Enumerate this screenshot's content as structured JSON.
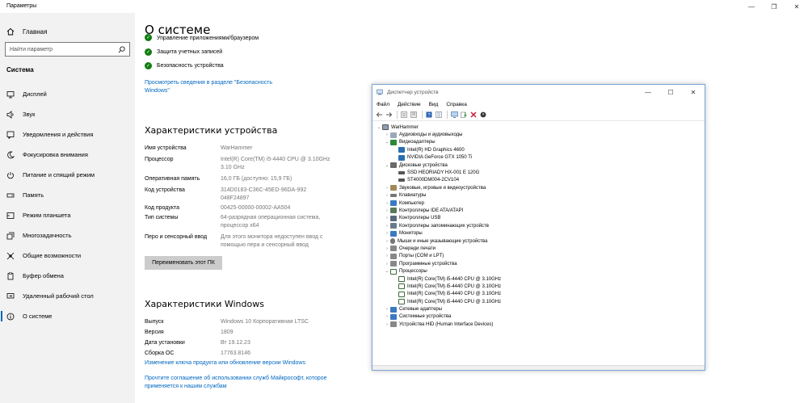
{
  "app_title": "Параметры",
  "window_controls": [
    "—",
    "❐",
    "✕"
  ],
  "sidebar": {
    "home_label": "Главная",
    "search_placeholder": "Найти параметр",
    "section_title": "Система",
    "items": [
      {
        "label": "Дисплей",
        "icon": "display-icon"
      },
      {
        "label": "Звук",
        "icon": "sound-icon"
      },
      {
        "label": "Уведомления и действия",
        "icon": "notifications-icon"
      },
      {
        "label": "Фокусировка внимания",
        "icon": "moon-icon"
      },
      {
        "label": "Питание и спящий режим",
        "icon": "power-icon"
      },
      {
        "label": "Память",
        "icon": "storage-icon"
      },
      {
        "label": "Режим планшета",
        "icon": "tablet-icon"
      },
      {
        "label": "Многозадачность",
        "icon": "multitasking-icon"
      },
      {
        "label": "Общие возможности",
        "icon": "shared-icon"
      },
      {
        "label": "Буфер обмена",
        "icon": "clipboard-icon"
      },
      {
        "label": "Удаленный рабочий стол",
        "icon": "remote-desktop-icon"
      },
      {
        "label": "О системе",
        "icon": "info-icon"
      }
    ]
  },
  "main": {
    "page_title": "О системе",
    "security": {
      "items": [
        "Управление приложениями/браузером",
        "Защита учетных записей",
        "Безопасность устройства"
      ],
      "link": "Просмотреть сведения в разделе \"Безопасность Windows\""
    },
    "device_specs": {
      "heading": "Характеристики устройства",
      "rows": [
        {
          "k": "Имя устройства",
          "v": "WarHammer"
        },
        {
          "k": "Процессор",
          "v": "Intel(R) Core(TM) i5-4440 CPU @ 3.10GHz 3.10 GHz"
        },
        {
          "k": "Оперативная память",
          "v": "16,0 ГБ (доступно: 15,9 ГБ)"
        },
        {
          "k": "Код устройства",
          "v": "314D0183-C36C-45ED-96DA-992048F24897"
        },
        {
          "k": "Код продукта",
          "v": "00425-00000-00002-AA504"
        },
        {
          "k": "Тип системы",
          "v": "64-разрядная операционная система, процессор x64"
        },
        {
          "k": "Перо и сенсорный ввод",
          "v": "Для этого монитора недоступен ввод с помощью пера и сенсорный ввод"
        }
      ],
      "rename_button": "Переименовать этот ПК"
    },
    "windows_specs": {
      "heading": "Характеристики Windows",
      "rows": [
        {
          "k": "Выпуск",
          "v": "Windows 10 Корпоративная LTSC"
        },
        {
          "k": "Версия",
          "v": "1809"
        },
        {
          "k": "Дата установки",
          "v": "Вт 19.12.23"
        },
        {
          "k": "Сборка ОС",
          "v": "17763.8146"
        }
      ],
      "link_key": "Изменение ключа продукта или обновление версии Windows",
      "link_license": "Прочтите соглашение об использовании служб Майкрософт, которое применяется к нашим службам"
    }
  },
  "device_manager": {
    "title": "Диспетчер устройств",
    "menu": [
      "Файл",
      "Действие",
      "Вид",
      "Справка"
    ],
    "tree": [
      {
        "level": 0,
        "exp": "⌄",
        "label": "WarHammer",
        "color": "#6a6a6a"
      },
      {
        "level": 1,
        "exp": "›",
        "label": "Аудиовходы и аудиовыходы",
        "color": "#7a8a99"
      },
      {
        "level": 1,
        "exp": "⌄",
        "label": "Видеоадаптеры",
        "color": "#2a8a3a"
      },
      {
        "level": 2,
        "exp": "",
        "label": "Intel(R) HD Graphics 4600",
        "color": "#2a6fb0"
      },
      {
        "level": 2,
        "exp": "",
        "label": "NVIDIA GeForce GTX 1050 Ti",
        "color": "#2a6fb0"
      },
      {
        "level": 1,
        "exp": "⌄",
        "label": "Дисковые устройства",
        "color": "#666666"
      },
      {
        "level": 2,
        "exp": "",
        "label": "SSD  HEORIADY  HX-001  E  120G",
        "color": "#555555"
      },
      {
        "level": 2,
        "exp": "",
        "label": "ST4000DM004-2CV104",
        "color": "#555555"
      },
      {
        "level": 1,
        "exp": "›",
        "label": "Звуковые, игровые и видеоустройства",
        "color": "#8a7a5a"
      },
      {
        "level": 1,
        "exp": "›",
        "label": "Клавиатуры",
        "color": "#666666"
      },
      {
        "level": 1,
        "exp": "›",
        "label": "Компьютер",
        "color": "#3a7ac0"
      },
      {
        "level": 1,
        "exp": "›",
        "label": "Контроллеры IDE ATA/ATAPI",
        "color": "#5a7a5a"
      },
      {
        "level": 1,
        "exp": "›",
        "label": "Контроллеры USB",
        "color": "#5a6a7a"
      },
      {
        "level": 1,
        "exp": "›",
        "label": "Контроллеры запоминающих устройств",
        "color": "#6a7a8a"
      },
      {
        "level": 1,
        "exp": "›",
        "label": "Мониторы",
        "color": "#3a7ac0"
      },
      {
        "level": 1,
        "exp": "›",
        "label": "Мыши и иные указывающие устройства",
        "color": "#777777"
      },
      {
        "level": 1,
        "exp": "›",
        "label": "Очереди печати",
        "color": "#777777"
      },
      {
        "level": 1,
        "exp": "›",
        "label": "Порты (COM и LPT)",
        "color": "#777777"
      },
      {
        "level": 1,
        "exp": "›",
        "label": "Программные устройства",
        "color": "#777777"
      },
      {
        "level": 1,
        "exp": "⌄",
        "label": "Процессоры",
        "color": "#3a6a3a"
      },
      {
        "level": 2,
        "exp": "",
        "label": "Intel(R) Core(TM) i5-4440 CPU @ 3.10GHz",
        "color": "#3a6a3a"
      },
      {
        "level": 2,
        "exp": "",
        "label": "Intel(R) Core(TM) i5-4440 CPU @ 3.10GHz",
        "color": "#3a6a3a"
      },
      {
        "level": 2,
        "exp": "",
        "label": "Intel(R) Core(TM) i5-4440 CPU @ 3.10GHz",
        "color": "#3a6a3a"
      },
      {
        "level": 2,
        "exp": "",
        "label": "Intel(R) Core(TM) i5-4440 CPU @ 3.10GHz",
        "color": "#3a6a3a"
      },
      {
        "level": 1,
        "exp": "›",
        "label": "Сетевые адаптеры",
        "color": "#3a7ac0"
      },
      {
        "level": 1,
        "exp": "›",
        "label": "Системные устройства",
        "color": "#3a7ac0"
      },
      {
        "level": 1,
        "exp": "›",
        "label": "Устройства HID (Human Interface Devices)",
        "color": "#777777"
      }
    ]
  },
  "colors": {
    "accent": "#0067c0",
    "ok_green": "#107c10"
  }
}
